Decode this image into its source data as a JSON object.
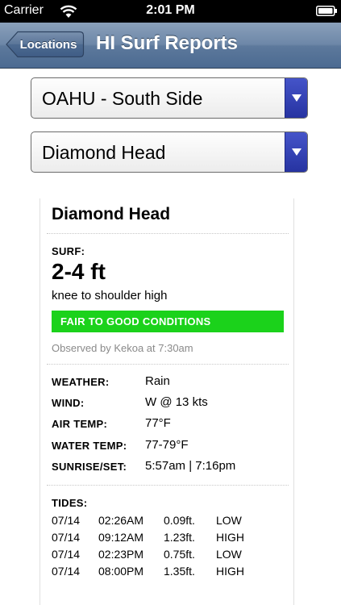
{
  "status_bar": {
    "carrier": "Carrier",
    "time": "2:01 PM"
  },
  "nav": {
    "back_label": "Locations",
    "title": "HI Surf Reports"
  },
  "selects": {
    "island": "OAHU - South Side",
    "spot": "Diamond Head"
  },
  "report": {
    "spot_name": "Diamond Head",
    "surf_label": "SURF:",
    "surf_height": "2-4 ft",
    "surf_description": "knee to shoulder high",
    "conditions": "FAIR TO GOOD CONDITIONS",
    "observed": "Observed by Kekoa at 7:30am",
    "details": [
      {
        "label": "WEATHER:",
        "value": "Rain"
      },
      {
        "label": "WIND:",
        "value": "W @ 13 kts"
      },
      {
        "label": "AIR TEMP:",
        "value": "77°F"
      },
      {
        "label": "WATER TEMP:",
        "value": "77-79°F"
      },
      {
        "label": "SUNRISE/SET:",
        "value": "5:57am | 7:16pm"
      }
    ],
    "tides_label": "TIDES:",
    "tides": [
      {
        "date": "07/14",
        "time": "02:26AM",
        "height": "0.09ft.",
        "type": "LOW"
      },
      {
        "date": "07/14",
        "time": "09:12AM",
        "height": "1.23ft.",
        "type": "HIGH"
      },
      {
        "date": "07/14",
        "time": "02:23PM",
        "height": "0.75ft.",
        "type": "LOW"
      },
      {
        "date": "07/14",
        "time": "08:00PM",
        "height": "1.35ft.",
        "type": "HIGH"
      }
    ]
  },
  "colors": {
    "nav_bar": "#5d799c",
    "conditions_good": "#1bd21b",
    "select_arrow": "#2633a1"
  }
}
